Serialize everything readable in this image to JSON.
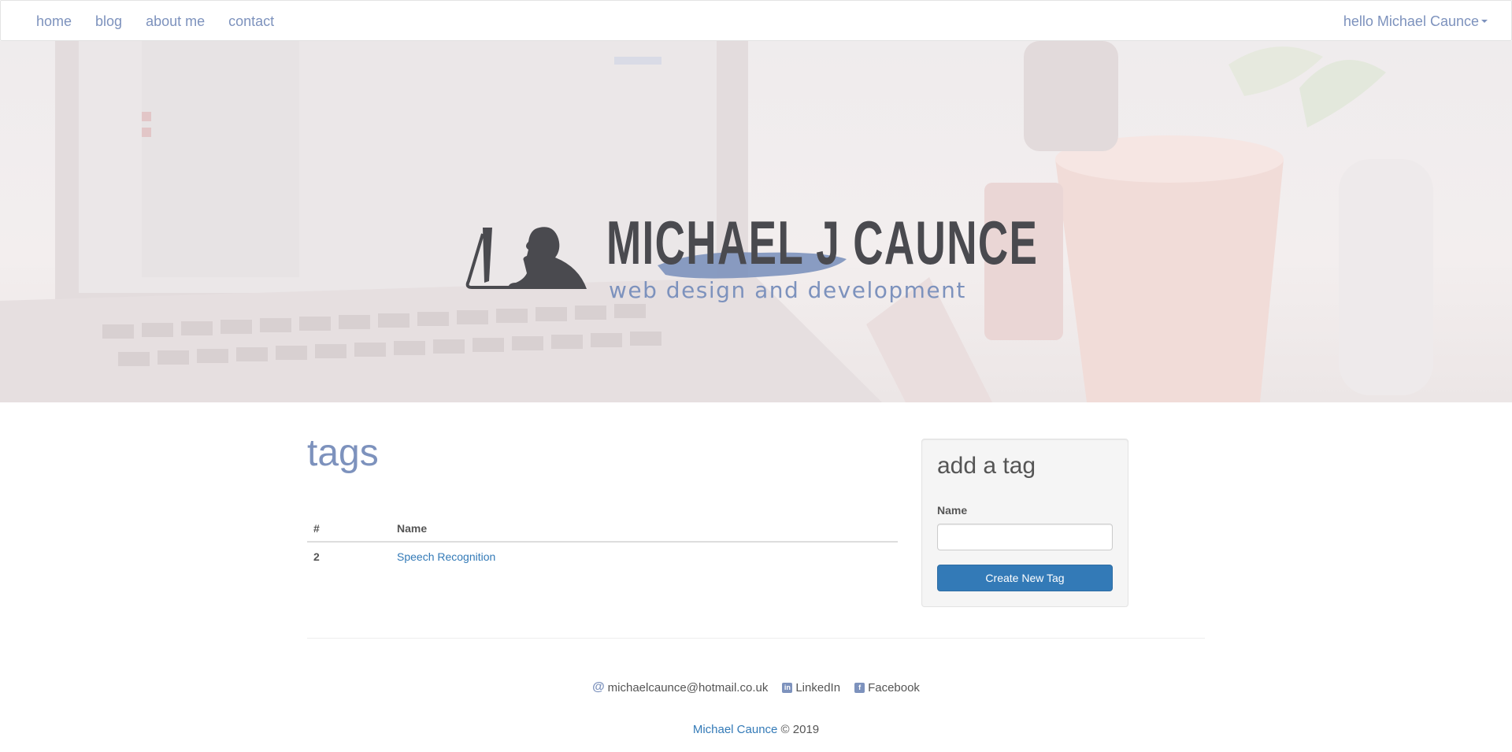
{
  "nav": {
    "links": [
      {
        "label": "home"
      },
      {
        "label": "blog"
      },
      {
        "label": "about me"
      },
      {
        "label": "contact"
      }
    ],
    "user_menu": "hello Michael Caunce"
  },
  "hero": {
    "logo_title": "MICHAEL J CAUNCE",
    "logo_subtitle": "web design and development"
  },
  "main": {
    "title": "tags",
    "table": {
      "headers": [
        "#",
        "Name"
      ],
      "rows": [
        {
          "id": "2",
          "name": "Speech Recognition"
        }
      ]
    }
  },
  "sidebar": {
    "title": "add a tag",
    "name_label": "Name",
    "name_value": "",
    "submit_label": "Create New Tag"
  },
  "footer": {
    "email": "michaelcaunce@hotmail.co.uk",
    "linkedin": "LinkedIn",
    "facebook": "Facebook",
    "copyright_name": "Michael Caunce",
    "copyright_suffix": " © 2019"
  },
  "colors": {
    "accent": "#7d92bd",
    "link": "#337ab7",
    "button": "#337ab7"
  },
  "icons": [
    "at-icon",
    "linkedin-icon",
    "facebook-icon",
    "caret-down-icon"
  ]
}
